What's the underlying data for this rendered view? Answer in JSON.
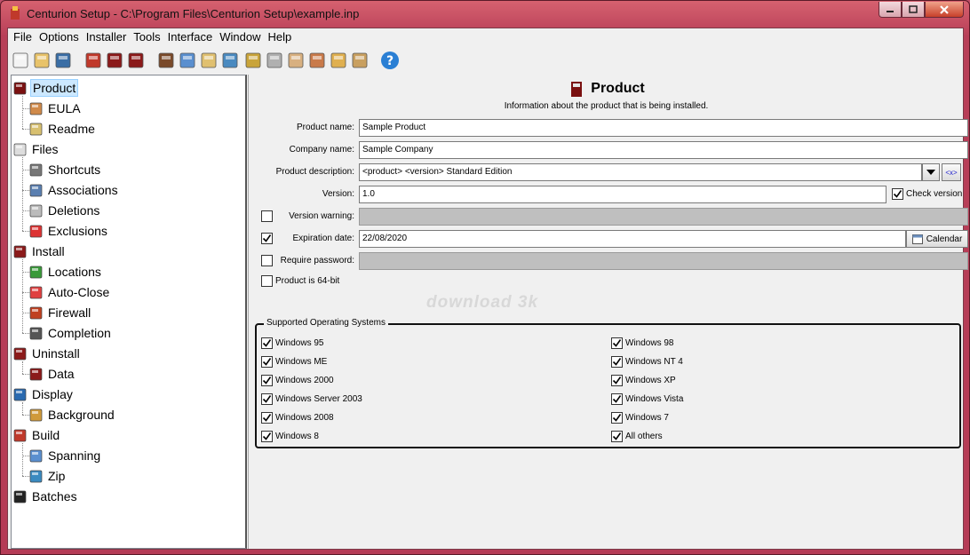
{
  "window": {
    "title": "Centurion Setup - C:\\Program Files\\Centurion Setup\\example.inp"
  },
  "menubar": {
    "items": [
      {
        "label": "File"
      },
      {
        "label": "Options"
      },
      {
        "label": "Installer"
      },
      {
        "label": "Tools"
      },
      {
        "label": "Interface"
      },
      {
        "label": "Window"
      },
      {
        "label": "Help"
      }
    ]
  },
  "toolbar": {
    "buttons": [
      {
        "icon": "new-file-icon"
      },
      {
        "icon": "open-folder-icon"
      },
      {
        "icon": "save-icon"
      },
      {
        "icon": "build-icon"
      },
      {
        "icon": "install-icon"
      },
      {
        "icon": "uninstall-icon"
      },
      {
        "icon": "files-icon"
      },
      {
        "icon": "spanning-icon"
      },
      {
        "icon": "edit-icon"
      },
      {
        "icon": "web-icon"
      },
      {
        "icon": "lock-icon"
      },
      {
        "icon": "copy-icon"
      },
      {
        "icon": "handshake-icon"
      },
      {
        "icon": "tool-icon"
      },
      {
        "icon": "scroll-icon"
      },
      {
        "icon": "package-icon"
      },
      {
        "icon": "help-icon"
      }
    ]
  },
  "tree": {
    "items": [
      {
        "label": "Product",
        "icon": "product-box-icon",
        "level": 0,
        "selected": true
      },
      {
        "label": "EULA",
        "icon": "eula-icon",
        "level": 1
      },
      {
        "label": "Readme",
        "icon": "readme-icon",
        "level": 1
      },
      {
        "label": "Files",
        "icon": "files-icon",
        "level": 0
      },
      {
        "label": "Shortcuts",
        "icon": "shortcut-icon",
        "level": 1
      },
      {
        "label": "Associations",
        "icon": "associations-icon",
        "level": 1
      },
      {
        "label": "Deletions",
        "icon": "deletions-icon",
        "level": 1
      },
      {
        "label": "Exclusions",
        "icon": "exclusions-icon",
        "level": 1
      },
      {
        "label": "Install",
        "icon": "install-icon",
        "level": 0
      },
      {
        "label": "Locations",
        "icon": "locations-icon",
        "level": 1
      },
      {
        "label": "Auto-Close",
        "icon": "auto-close-icon",
        "level": 1
      },
      {
        "label": "Firewall",
        "icon": "firewall-icon",
        "level": 1
      },
      {
        "label": "Completion",
        "icon": "completion-icon",
        "level": 1
      },
      {
        "label": "Uninstall",
        "icon": "uninstall-icon",
        "level": 0
      },
      {
        "label": "Data",
        "icon": "data-icon",
        "level": 1
      },
      {
        "label": "Display",
        "icon": "display-icon",
        "level": 0
      },
      {
        "label": "Background",
        "icon": "background-icon",
        "level": 1
      },
      {
        "label": "Build",
        "icon": "build-icon",
        "level": 0
      },
      {
        "label": "Spanning",
        "icon": "spanning-icon",
        "level": 1
      },
      {
        "label": "Zip",
        "icon": "zip-icon",
        "level": 1
      },
      {
        "label": "Batches",
        "icon": "batches-icon",
        "level": 0
      }
    ]
  },
  "panel": {
    "title": "Product",
    "subtitle": "Information about the product that is being installed.",
    "fields": {
      "product_name": {
        "label": "Product name:",
        "value": "Sample Product"
      },
      "company_name": {
        "label": "Company name:",
        "value": "Sample Company"
      },
      "product_description": {
        "label": "Product description:",
        "value": "<product> <version> Standard Edition"
      },
      "version": {
        "label": "Version:",
        "value": "1.0"
      },
      "check_version": {
        "label": "Check version",
        "checked": true
      },
      "version_warning": {
        "label": "Version warning:",
        "checked": false,
        "value": ""
      },
      "expiration_date": {
        "label": "Expiration date:",
        "checked": true,
        "value": "22/08/2020"
      },
      "calendar_button": {
        "label": "Calendar"
      },
      "require_password": {
        "label": "Require password:",
        "checked": false,
        "value": ""
      },
      "product_64bit": {
        "label": "Product is 64-bit",
        "checked": false
      }
    },
    "macro_button": {
      "label": "<x>"
    },
    "os_group": {
      "title": "Supported Operating Systems",
      "left": [
        {
          "label": "Windows 95",
          "checked": true
        },
        {
          "label": "Windows ME",
          "checked": true
        },
        {
          "label": "Windows 2000",
          "checked": true
        },
        {
          "label": "Windows Server 2003",
          "checked": true
        },
        {
          "label": "Windows 2008",
          "checked": true
        },
        {
          "label": "Windows 8",
          "checked": true
        }
      ],
      "right": [
        {
          "label": "Windows 98",
          "checked": true
        },
        {
          "label": "Windows NT 4",
          "checked": true
        },
        {
          "label": "Windows XP",
          "checked": true
        },
        {
          "label": "Windows Vista",
          "checked": true
        },
        {
          "label": "Windows 7",
          "checked": true
        },
        {
          "label": "All others",
          "checked": true
        }
      ]
    }
  },
  "watermark": "download 3k",
  "colors": {
    "frame": "#c0506a",
    "selection": "#cce8ff",
    "disabled_field": "#bfbfbf",
    "help_icon": "#2a7fd4"
  }
}
